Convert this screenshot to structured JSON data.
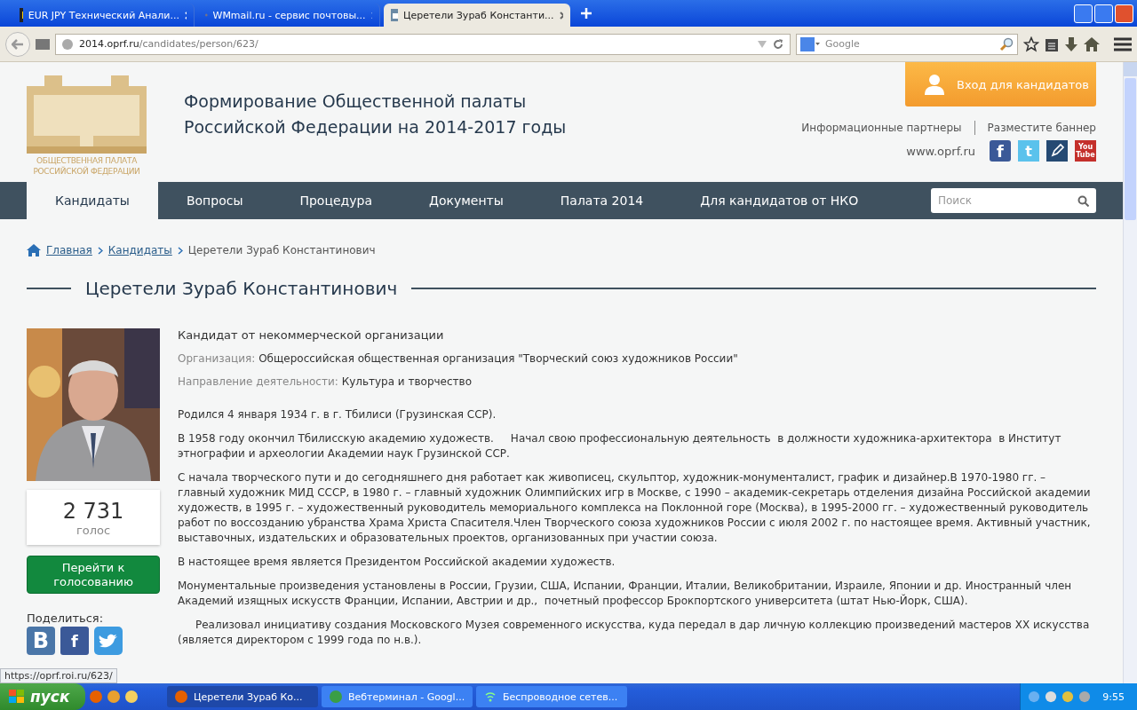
{
  "browser": {
    "tabs": [
      {
        "kind": "inv",
        "title": "EUR JPY Технический Анали...",
        "selected": false
      },
      {
        "kind": "mail",
        "title": "WMmail.ru - сервис почтовы...",
        "selected": false
      },
      {
        "kind": "site",
        "title": "Церетели Зураб Константи...",
        "selected": true
      }
    ],
    "address_host": "2014.oprf.ru",
    "address_path": "/candidates/person/623/",
    "search_placeholder": "Google",
    "status_url": "https://oprf.roi.ru/623/"
  },
  "header": {
    "logo_lines": [
      "ОБЩЕСТВЕННАЯ ПАЛАТА",
      "РОССИЙСКОЙ ФЕДЕРАЦИИ"
    ],
    "title_lines": [
      "Формирование Общественной палаты",
      "Российской Федерации на 2014-2017 годы"
    ],
    "login_button": "Вход для кандидатов",
    "links": [
      "Информационные партнеры",
      "Разместите баннер"
    ],
    "site_url": "www.oprf.ru",
    "social": [
      {
        "kind": "facebook",
        "label": "f"
      },
      {
        "kind": "twitter",
        "label": "t"
      },
      {
        "kind": "pen"
      },
      {
        "kind": "youtube",
        "label": "You Tube"
      }
    ]
  },
  "nav": {
    "items": [
      {
        "label": "Кандидаты",
        "selected": true
      },
      {
        "label": "Вопросы",
        "selected": false
      },
      {
        "label": "Процедура",
        "selected": false
      },
      {
        "label": "Документы",
        "selected": false
      },
      {
        "label": "Палата 2014",
        "selected": false
      },
      {
        "label": "Для кандидатов от НКО",
        "selected": false
      }
    ],
    "search_placeholder": "Поиск"
  },
  "breadcrumbs": [
    {
      "label": "Главная",
      "kind": "link"
    },
    {
      "label": "Кандидаты",
      "kind": "link"
    },
    {
      "label": "Церетели Зураб Константинович",
      "kind": "current"
    }
  ],
  "heading": "Церетели Зураб Константинович",
  "candidate": {
    "votes": "2 731",
    "votes_label": "голос",
    "vote_button": "Перейти к голосованию",
    "share_label": "Поделиться:",
    "share": [
      {
        "kind": "vk",
        "label": "B"
      },
      {
        "kind": "facebook",
        "label": "f"
      },
      {
        "kind": "twitter"
      }
    ],
    "type": "Кандидат от некоммерческой организации",
    "fields": [
      {
        "label": "Организация:",
        "value": "Общероссийская общественная организация \"Творческий союз художников России\""
      },
      {
        "label": "Направление деятельности:",
        "value": "Культура и творчество"
      }
    ],
    "bio": [
      {
        "text": "Родился 4 января 1934 г. в г. Тбилиси (Грузинская ССР).",
        "indent": false
      },
      {
        "text": "В 1958 году окончил Тбилисскую академию художеств.     Начал свою профессиональную деятельность  в должности художника-архитектора  в Институт этнографии и археологии Академии наук Грузинской ССР.",
        "indent": false
      },
      {
        "text": "С начала творческого пути и до сегодняшнего дня работает как живописец, скульптор, художник-монументалист, график и дизайнер.В 1970-1980 гг. – главный художник МИД СССР, в 1980 г. – главный художник Олимпийских игр в Москве, с 1990 – академик-секретарь отделения дизайна Российской академии художеств, в 1995 г. – художественный руководитель мемориального комплекса на Поклонной горе (Москва), в 1995-2000 гг. – художественный руководитель работ по воссозданию убранства Храма Христа Спасителя.Член Творческого союза художников России с июля 2002 г. по настоящее время. Активный участник, выставочных, издательских и образовательных проектов, организованных при участии союза.",
        "indent": false
      },
      {
        "text": "В настоящее время является Президентом Российской академии художеств.",
        "indent": false
      },
      {
        "text": "Монументальные произведения установлены в России, Грузии, США, Испании, Франции, Италии, Великобритании, Израиле, Японии и др. Иностранный член Академий изящных искусств Франции, Испании, Австрии и др.,  почетный профессор Брокпортского университета (штат Нью-Йорк, США).",
        "indent": false
      },
      {
        "text": "Реализовал инициативу создания Московского Музея современного искусства, куда передал в дар личную коллекцию произведений мастеров XX искусства (является директором с 1999 года по н.в.).",
        "indent": true
      }
    ]
  },
  "taskbar": {
    "start": "пуск",
    "tasks": [
      {
        "kind": "firefox",
        "label": "Церетели Зураб Ко...",
        "selected": true
      },
      {
        "kind": "chrome",
        "label": "Вебтерминал - Googl...",
        "selected": false
      },
      {
        "kind": "wifi",
        "label": "Беспроводное сетев...",
        "selected": false
      }
    ],
    "clock": "9:55"
  }
}
